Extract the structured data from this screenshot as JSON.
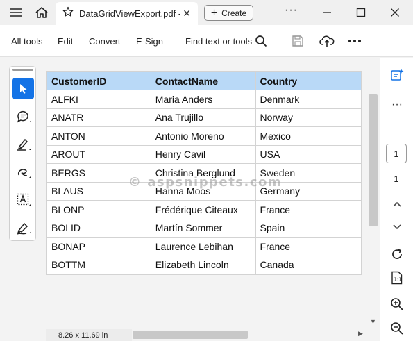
{
  "window": {
    "tab_title": "DataGridViewExport.pdf - Adobe Acrobat",
    "create_label": "Create",
    "more": "···"
  },
  "toolbar": {
    "all_tools": "All tools",
    "edit": "Edit",
    "convert": "Convert",
    "esign": "E-Sign",
    "find": "Find text or tools"
  },
  "table": {
    "headers": [
      "CustomerID",
      "ContactName",
      "Country"
    ],
    "rows": [
      [
        "ALFKI",
        "Maria Anders",
        "Denmark"
      ],
      [
        "ANATR",
        "Ana Trujillo",
        "Norway"
      ],
      [
        "ANTON",
        "Antonio Moreno",
        "Mexico"
      ],
      [
        "AROUT",
        "Henry Cavil",
        "USA"
      ],
      [
        "BERGS",
        "Christina Berglund",
        "Sweden"
      ],
      [
        "BLAUS",
        "Hanna Moos",
        "Germany"
      ],
      [
        "BLONP",
        "Frédérique Citeaux",
        "France"
      ],
      [
        "BOLID",
        "Martín Sommer",
        "Spain"
      ],
      [
        "BONAP",
        "Laurence Lebihan",
        "France"
      ],
      [
        "BOTTM",
        "Elizabeth Lincoln",
        "Canada"
      ]
    ]
  },
  "watermark": "© aspsnippets.com",
  "status": {
    "page_size": "8.26 x 11.69 in"
  },
  "navigation": {
    "current_page": "1",
    "total_pages": "1",
    "more": "···"
  },
  "colors": {
    "accent": "#1473e6",
    "header_bg": "#b9d9f7",
    "grid_border": "#d3d3d3"
  }
}
